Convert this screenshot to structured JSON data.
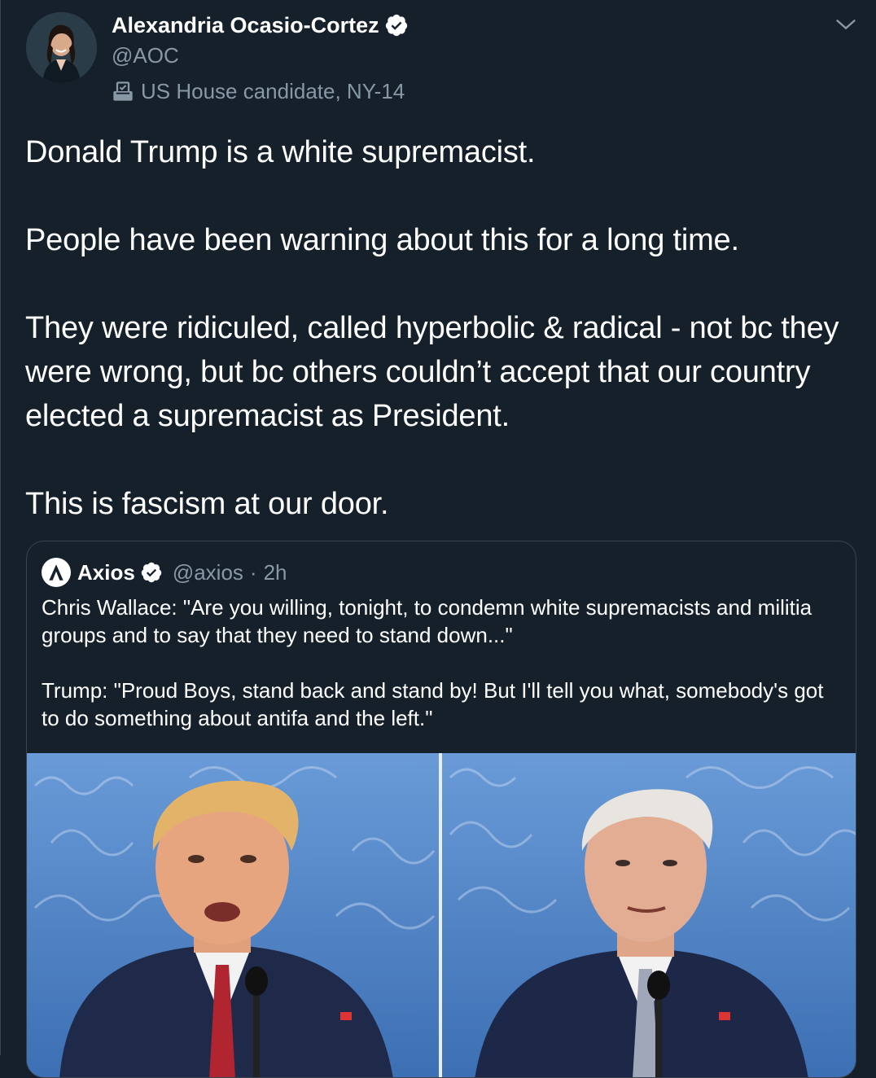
{
  "tweet": {
    "author": {
      "display_name": "Alexandria Ocasio-Cortez",
      "handle": "@AOC",
      "label": "US House candidate, NY-14",
      "avatar_icon": "avatar-photo",
      "verified_icon": "verified-badge-icon",
      "label_icon": "ballot-box-icon"
    },
    "menu_icon": "chevron-down-icon",
    "text": {
      "p1": "Donald Trump is a white supremacist.",
      "p2": "People have been warning about this for a long time.",
      "p3": "They were ridiculed, called hyperbolic & radical - not bc they were wrong, but bc others couldn’t accept that our country elected a supremacist as President.",
      "p4": "This is fascism at our door."
    },
    "quote": {
      "display_name": "Axios",
      "handle": "@axios",
      "separator": "·",
      "time": "2h",
      "p1": "Chris Wallace: \"Are you willing, tonight, to condemn white supremacists and militia groups and to say that they need to stand down...\"",
      "p2": "Trump: \"Proud Boys, stand back and stand by! But I'll tell you what, somebody's got to do something about antifa and the left.\"",
      "media_alt": "Debate split-screen photo of two candidates at podiums"
    }
  },
  "colors": {
    "background": "#15202b",
    "text_primary": "#ffffff",
    "text_secondary": "#8899a6",
    "border": "#38444d",
    "verified": "#ffffff"
  }
}
